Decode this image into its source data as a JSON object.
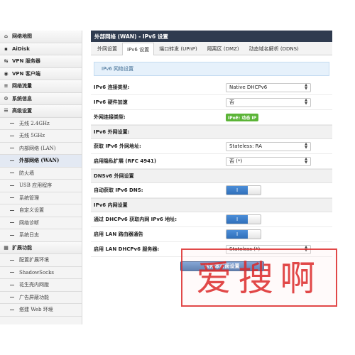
{
  "sidebar": {
    "items": [
      {
        "label": "网络地图",
        "icon": "home-icon",
        "level": "top",
        "active": false
      },
      {
        "label": "AiDisk",
        "icon": "disk-icon",
        "level": "top",
        "active": false
      },
      {
        "label": "VPN 服务器",
        "icon": "vpn-icon",
        "level": "top",
        "active": false
      },
      {
        "label": "VPN 客户端",
        "icon": "globe-icon",
        "level": "top",
        "active": false
      },
      {
        "label": "网络流量",
        "icon": "traffic-icon",
        "level": "top",
        "active": false
      },
      {
        "label": "系统信息",
        "icon": "sysinfo-icon",
        "level": "top",
        "active": false
      },
      {
        "label": "高级设置",
        "icon": "settings-icon",
        "level": "top",
        "active": false
      },
      {
        "label": "无线 2.4GHz",
        "level": "sub",
        "active": false
      },
      {
        "label": "无线 5GHz",
        "level": "sub",
        "active": false
      },
      {
        "label": "内部网络 (LAN)",
        "level": "sub",
        "active": false
      },
      {
        "label": "外部网络 (WAN)",
        "level": "sub",
        "active": true
      },
      {
        "label": "防火墙",
        "level": "sub",
        "active": false
      },
      {
        "label": "USB 应用程序",
        "level": "sub",
        "active": false
      },
      {
        "label": "系统管理",
        "level": "sub",
        "active": false
      },
      {
        "label": "自定义设置",
        "level": "sub",
        "active": false
      },
      {
        "label": "网络诊断",
        "level": "sub",
        "active": false
      },
      {
        "label": "系统日志",
        "level": "sub",
        "active": false
      },
      {
        "label": "扩展功能",
        "icon": "extensions-icon",
        "level": "top",
        "active": false
      },
      {
        "label": "配置扩展环境",
        "level": "sub",
        "active": false
      },
      {
        "label": "ShadowSocks",
        "level": "sub",
        "active": false
      },
      {
        "label": "花生壳内网版",
        "level": "sub",
        "active": false
      },
      {
        "label": "广告屏蔽功能",
        "level": "sub",
        "active": false
      },
      {
        "label": "搭建 Web 环境",
        "level": "sub",
        "active": false
      }
    ]
  },
  "main": {
    "title": "外部网络 (WAN) - IPv6 设置",
    "tabs": [
      {
        "label": "外网设置",
        "active": false
      },
      {
        "label": "IPv6 设置",
        "active": true
      },
      {
        "label": "端口转发 (UPnP)",
        "active": false
      },
      {
        "label": "隔离区 (DMZ)",
        "active": false
      },
      {
        "label": "动态域名解析 (DDNS)",
        "active": false
      }
    ],
    "alert": "IPv6 网络设置",
    "rows1": [
      {
        "label": "IPv6 连接类型:",
        "type": "select",
        "value": "Native DHCPv6"
      },
      {
        "label": "IPv6 硬件加速",
        "type": "select",
        "value": "否"
      },
      {
        "label": "外网连接类型:",
        "type": "badge",
        "value": "IPoE: 动态 IP"
      }
    ],
    "section_wan": "IPv6 外网设置:",
    "rows2": [
      {
        "label": "获取 IPv6 外网地址:",
        "type": "select",
        "value": "Stateless: RA"
      },
      {
        "label": "启用隐私扩展 (RFC 4941)",
        "type": "select",
        "value": "否 (*)"
      }
    ],
    "section_dns": "DNSv6 外网设置",
    "rows3": [
      {
        "label": "自动获取 IPv6 DNS:",
        "type": "toggle",
        "value": "I"
      }
    ],
    "section_lan": "IPv6 内网设置",
    "rows4": [
      {
        "label": "通过 DHCPv6 获取内网 IPv6 地址:",
        "type": "toggle",
        "value": "I"
      },
      {
        "label": "启用 LAN 路由器通告",
        "type": "toggle",
        "value": "I"
      },
      {
        "label": "启用 LAN DHCPv6 服务器:",
        "type": "select",
        "value": "Stateless (*)"
      }
    ],
    "apply_label": "应用本页面设置"
  },
  "watermark": {
    "text": "爱搜啊",
    "color": "#dc2828"
  }
}
